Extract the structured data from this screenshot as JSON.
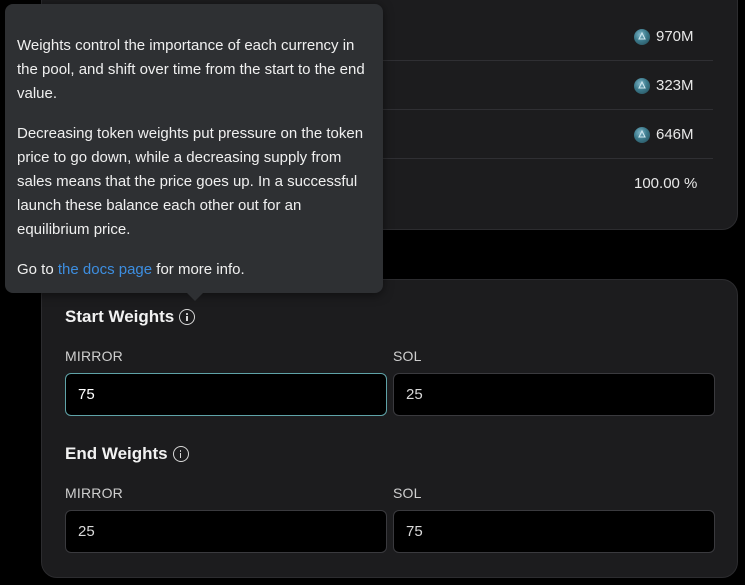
{
  "pool_summary": {
    "rows": [
      {
        "value": "970M",
        "icon": "coin-icon"
      },
      {
        "value": "323M",
        "icon": "coin-icon"
      },
      {
        "value": "646M",
        "icon": "coin-icon"
      },
      {
        "value": "100.00 %",
        "icon": ""
      }
    ]
  },
  "weights": {
    "start": {
      "title": "Start Weights",
      "token_a_label": "MIRROR",
      "token_a_value": "75",
      "token_b_label": "SOL",
      "token_b_value": "25"
    },
    "end": {
      "title": "End Weights",
      "token_a_label": "MIRROR",
      "token_a_value": "25",
      "token_b_label": "SOL",
      "token_b_value": "75"
    }
  },
  "tooltip": {
    "paragraph_1": "Weights control the importance of each currency in the pool, and shift over time from the start to the end value.",
    "paragraph_2": "Decreasing token weights put pressure on the token price to go down, while a decreasing supply from sales means that the price goes up. In a successful launch these balance each other out for an equilibrium price.",
    "link_prefix": "Go to ",
    "link_text": "the docs page",
    "link_suffix": " for more info."
  },
  "colors": {
    "background": "#000000",
    "card": "#1c1c1e",
    "tooltip": "#2e3033",
    "link": "#3d8ee0",
    "focus_border": "#5fa3a8"
  }
}
